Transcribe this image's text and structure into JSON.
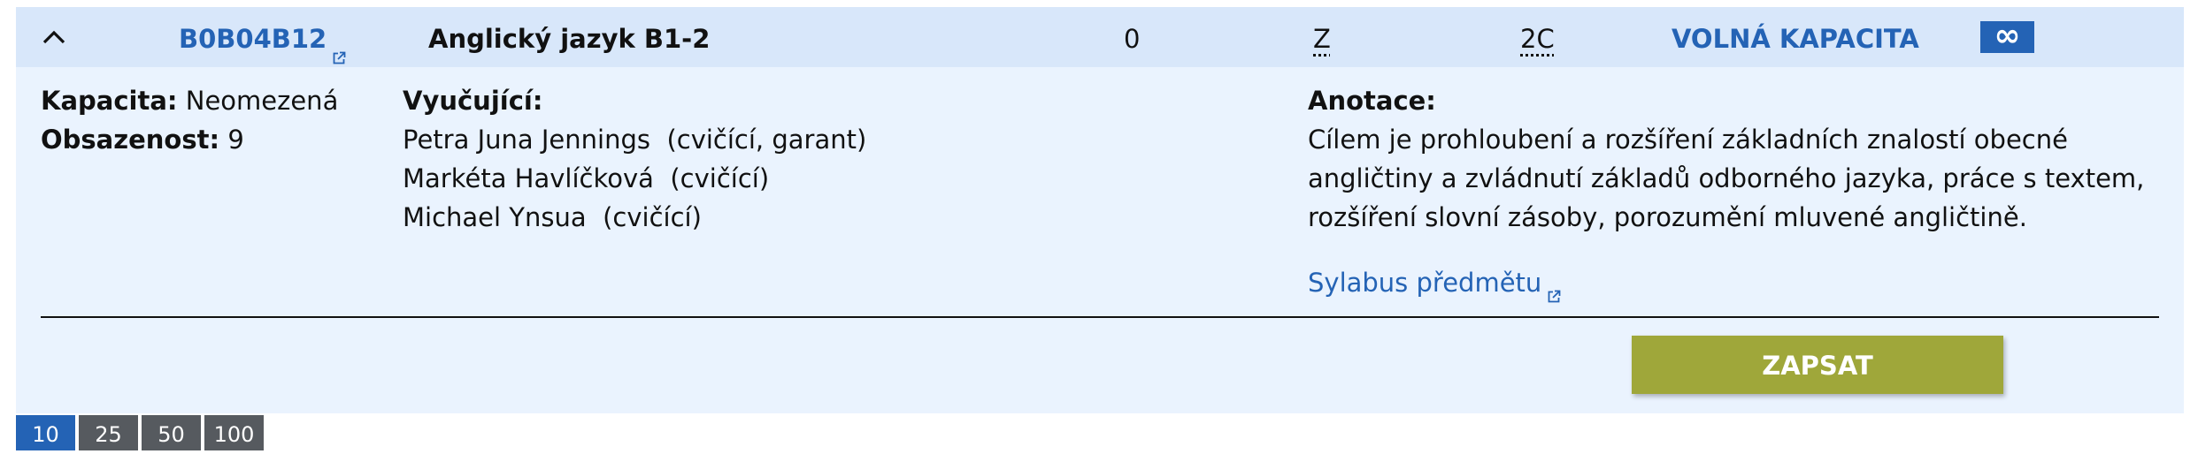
{
  "course": {
    "code": "B0B04B12",
    "name": "Anglický jazyk B1-2",
    "credits": "0",
    "completion": "Z",
    "extent": "2C",
    "status": "VOLNÁ KAPACITA",
    "capacity_symbol": "∞",
    "status_color": "#2463b5"
  },
  "details": {
    "capacity_label": "Kapacita:",
    "capacity_value": "Neomezená",
    "occupancy_label": "Obsazenost:",
    "occupancy_value": "9",
    "teachers_label": "Vyučující:",
    "teachers": [
      {
        "name": "Petra Juna Jennings",
        "role": "(cvičící, garant)"
      },
      {
        "name": "Markéta Havlíčková",
        "role": "(cvičící)"
      },
      {
        "name": "Michael Ynsua",
        "role": "(cvičící)"
      }
    ],
    "annotation_label": "Anotace:",
    "annotation_lines": [
      "Cílem je prohloubení a rozšíření základních znalostí obecné",
      "angličtiny a zvládnutí základů odborného jazyka, práce s textem,",
      "rozšíření slovní zásoby, porozumění mluvené angličtině."
    ],
    "syllabus_link": "Sylabus předmětu"
  },
  "actions": {
    "enroll_label": "ZAPSAT",
    "enroll_color": "#9fa73a"
  },
  "pagination": {
    "page_sizes": [
      "10",
      "25",
      "50",
      "100"
    ],
    "active_index": 0
  },
  "icons": [
    "chevron-up-icon",
    "external-link-icon",
    "infinity-icon"
  ]
}
